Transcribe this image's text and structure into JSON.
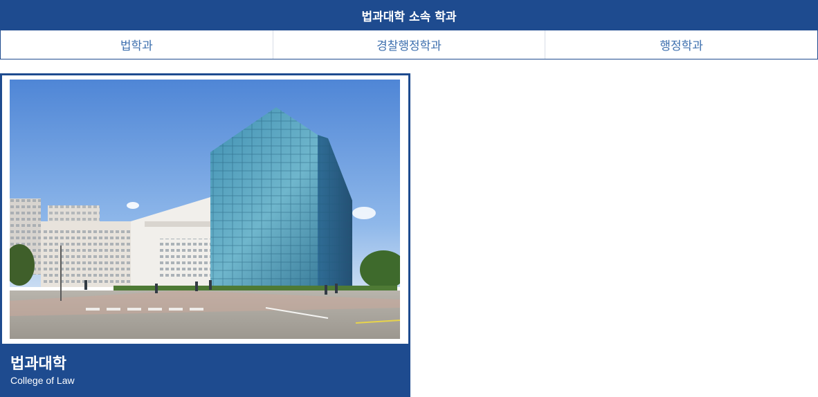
{
  "department_section": {
    "header": "법과대학 소속 학과",
    "tabs": [
      {
        "label": "법학과"
      },
      {
        "label": "경찰행정학과"
      },
      {
        "label": "행정학과"
      }
    ]
  },
  "college_card": {
    "title": "법과대학",
    "subtitle": "College of Law",
    "photo_alt": "법과대학"
  },
  "colors": {
    "primary": "#1e4b8f",
    "tab_text": "#3d6fae",
    "white": "#ffffff"
  }
}
